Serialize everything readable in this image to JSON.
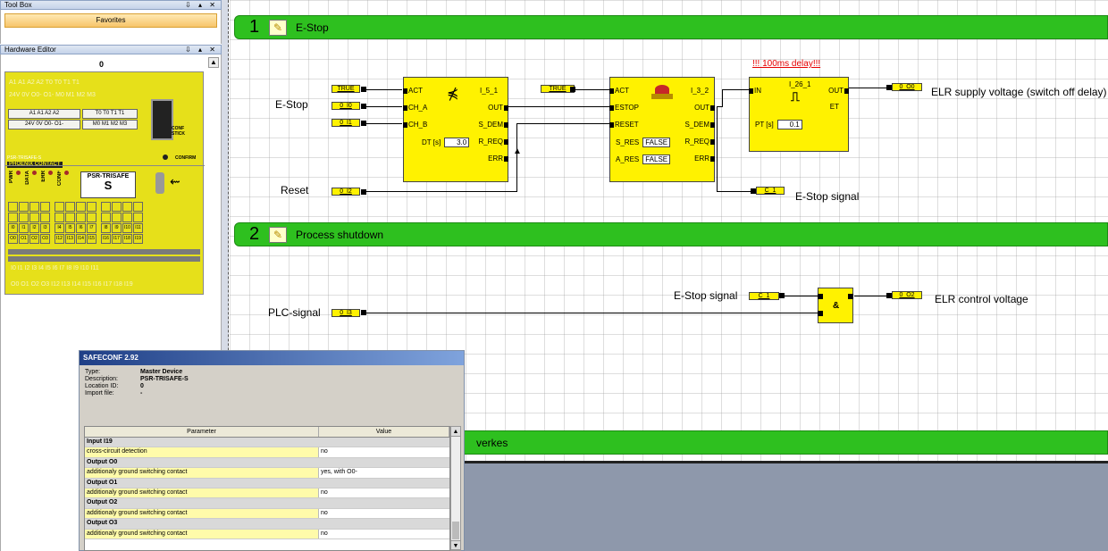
{
  "toolbox": {
    "title": "Tool Box",
    "controls": "⇩ ▴ ✕",
    "favorites": "Favorites"
  },
  "hardware_editor": {
    "title": "Hardware Editor",
    "controls": "⇩ ▴ ✕",
    "index": "0",
    "device": {
      "top_row1": "A1 A1 A2 A2   T0 T0 T1 T1",
      "top_row2": "24V 0V O0- O1-   M0 M1 M2 M3",
      "row1": [
        "A1",
        "A1",
        "A2",
        "A2",
        "T0",
        "T0",
        "T1",
        "T1"
      ],
      "row2": [
        "24V",
        "0V",
        "O0-",
        "O1-",
        "M0",
        "M1",
        "M2",
        "M3"
      ],
      "stick": "CONF STICK",
      "confirm": "CONFIRM",
      "brand": "PHOENIX CONTACT",
      "model_small": "PSR-TRISAFE-S",
      "name_line1": "PSR-TRISAFE",
      "name_line2": "S",
      "leds": [
        "PWR",
        "DATA",
        "ERR",
        "CONF"
      ],
      "io_row1": [
        "I0",
        "I1",
        "I2",
        "I3",
        "I4",
        "I5",
        "I6",
        "I7",
        "I8",
        "I9",
        "I10",
        "I11"
      ],
      "io_row2": [
        "O0",
        "O1",
        "O2",
        "O3",
        "I12",
        "I13",
        "I14",
        "I15",
        "I16",
        "I17",
        "I18",
        "I19"
      ],
      "bottom_row1": "I0 I1 I2 I3   I4 I5 I6 I7   I8 I9 I10 I11",
      "bottom_row2": "O0 O1 O2 O3   I12 I13 I14 I15   I16 I17 I18 I19"
    }
  },
  "networks": [
    {
      "number": "1",
      "title": "E-Stop"
    },
    {
      "number": "2",
      "title": "Process shutdown"
    },
    {
      "number": "",
      "title": "verkes"
    }
  ],
  "net1": {
    "label_estop": "E-Stop",
    "label_reset": "Reset",
    "vars": {
      "true1": "TRUE",
      "i0": "0_I0",
      "i1": "0_I1",
      "i2": "0_I2",
      "true2": "TRUE",
      "o0": "0_O0",
      "c1": "C_1"
    },
    "fb1": {
      "name": "I_5_1",
      "pins_in": [
        "ACT",
        "CH_A",
        "CH_B"
      ],
      "pins_out": [
        "OUT",
        "S_DEM",
        "R_REQ",
        "ERR"
      ],
      "param_label": "DT [s]",
      "param_value": "3.0"
    },
    "fb2": {
      "name": "I_3_2",
      "pins_in": [
        "ACT",
        "ESTOP",
        "RESET",
        "S_RES",
        "A_RES"
      ],
      "pins_out": [
        "OUT",
        "S_DEM",
        "R_REQ",
        "ERR"
      ],
      "s_res_value": "FALSE",
      "a_res_value": "FALSE"
    },
    "fb3": {
      "name": "I_26_1",
      "pin_in": "IN",
      "pin_out": "OUT",
      "pin_et": "ET",
      "param_label": "PT [s]",
      "param_value": "0.1"
    },
    "delay_note": "!!! 100ms delay!!!",
    "elr_supply": "ELR supply voltage (switch off delay)",
    "estop_signal": "E-Stop signal"
  },
  "net2": {
    "label_plc": "PLC-signal",
    "label_estop_signal": "E-Stop signal",
    "label_elr_control": "ELR control voltage",
    "vars": {
      "i3": "0_I3",
      "c1": "C_1",
      "o2": "0_O2"
    },
    "and_label": "&"
  },
  "dialog": {
    "title": "SAFECONF 2.92",
    "info": [
      {
        "key": "Type:",
        "value": "Master Device"
      },
      {
        "key": "Description:",
        "value": "PSR-TRISAFE-S"
      },
      {
        "key": "Location ID:",
        "value": "0"
      },
      {
        "key": "Import file:",
        "value": "-"
      }
    ],
    "columns": [
      "Parameter",
      "Value"
    ],
    "rows": [
      {
        "kind": "group",
        "param": "Input I19",
        "value": ""
      },
      {
        "kind": "param",
        "param": "cross-circuit detection",
        "value": "no"
      },
      {
        "kind": "group",
        "param": "Output O0",
        "value": ""
      },
      {
        "kind": "param",
        "param": "additionaly ground switching contact",
        "value": "yes, with O0-"
      },
      {
        "kind": "group",
        "param": "Output O1",
        "value": ""
      },
      {
        "kind": "param",
        "param": "additionaly ground switching contact",
        "value": "no"
      },
      {
        "kind": "group",
        "param": "Output O2",
        "value": ""
      },
      {
        "kind": "param",
        "param": "additionaly ground switching contact",
        "value": "no"
      },
      {
        "kind": "group",
        "param": "Output O3",
        "value": ""
      },
      {
        "kind": "param",
        "param": "additionaly ground switching contact",
        "value": "no"
      }
    ]
  }
}
